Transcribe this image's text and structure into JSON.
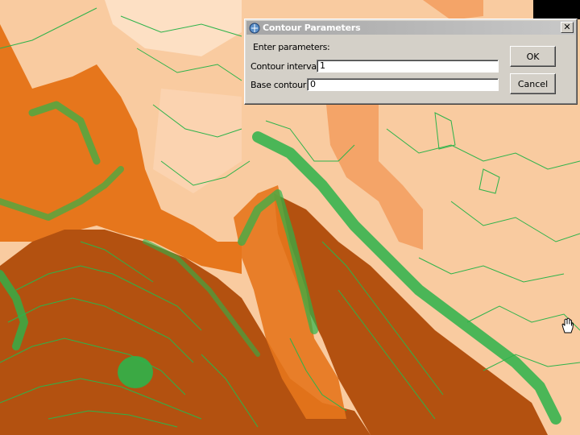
{
  "dialog": {
    "title": "Contour Parameters",
    "prompt": "Enter parameters:",
    "contour_interval_label": "Contour interval:",
    "contour_interval_value": "1",
    "base_contour_label": "Base contour:",
    "base_contour_value": "0",
    "ok_label": "OK",
    "cancel_label": "Cancel",
    "close_glyph": "✕"
  },
  "colors": {
    "lowland": "#f9cba0",
    "sand": "#f4a468",
    "orange": "#e6761c",
    "brown": "#b35110",
    "contour_green": "#2db34a",
    "dialog_gray": "#d4d0c8"
  },
  "icons": [
    "map-app-icon",
    "close-icon",
    "hand-cursor-icon"
  ]
}
